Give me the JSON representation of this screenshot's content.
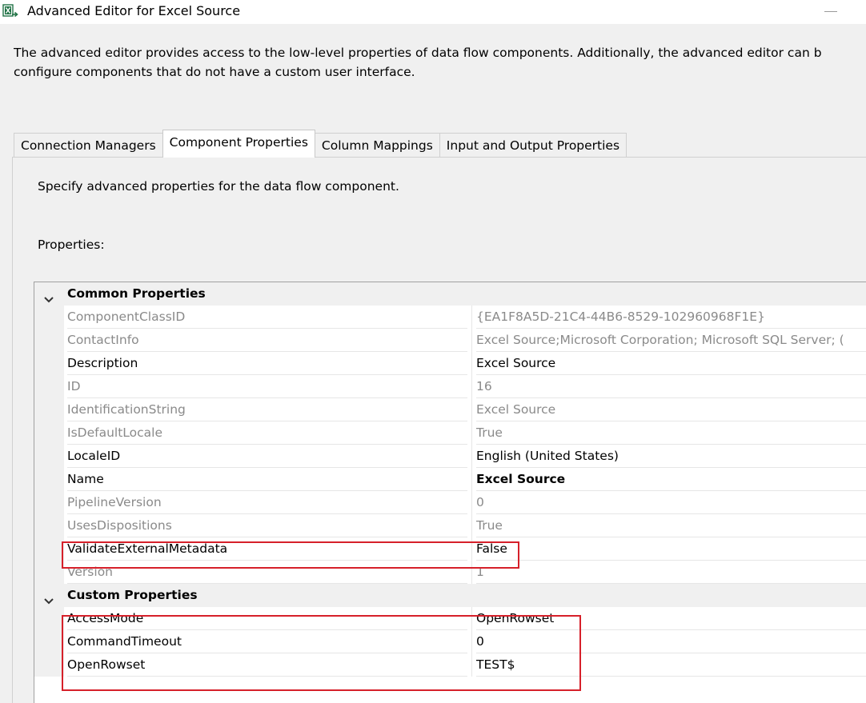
{
  "window": {
    "title": "Advanced Editor for Excel Source",
    "app_icon": "excel-source-icon",
    "minimize_icon": "minimize-icon"
  },
  "description": {
    "line1": "The advanced editor provides access to the low-level properties of data flow components. Additionally, the advanced editor can b",
    "line2": "configure components that do not have a custom user interface."
  },
  "tabs": [
    {
      "label": "Connection Managers",
      "active": false
    },
    {
      "label": "Component Properties",
      "active": true
    },
    {
      "label": "Column Mappings",
      "active": false
    },
    {
      "label": "Input and Output Properties",
      "active": false
    }
  ],
  "panel": {
    "description": "Specify advanced properties for the data flow component.",
    "properties_label": "Properties:"
  },
  "grid": {
    "categories": [
      {
        "label": "Common Properties",
        "expanded": true,
        "rows": [
          {
            "name": "ComponentClassID",
            "value": "{EA1F8A5D-21C4-44B6-8529-102960968F1E}",
            "readonly": true
          },
          {
            "name": "ContactInfo",
            "value": "Excel Source;Microsoft Corporation; Microsoft SQL Server; (",
            "readonly": true
          },
          {
            "name": "Description",
            "value": "Excel Source",
            "readonly": false
          },
          {
            "name": "ID",
            "value": "16",
            "readonly": true
          },
          {
            "name": "IdentificationString",
            "value": "Excel Source",
            "readonly": true
          },
          {
            "name": "IsDefaultLocale",
            "value": "True",
            "readonly": true
          },
          {
            "name": "LocaleID",
            "value": "English (United States)",
            "readonly": false
          },
          {
            "name": "Name",
            "value": "Excel Source",
            "readonly": false,
            "bold_value": true
          },
          {
            "name": "PipelineVersion",
            "value": "0",
            "readonly": true
          },
          {
            "name": "UsesDispositions",
            "value": "True",
            "readonly": true
          },
          {
            "name": "ValidateExternalMetadata",
            "value": "False",
            "readonly": false,
            "highlighted": true
          },
          {
            "name": "Version",
            "value": "1",
            "readonly": true
          }
        ]
      },
      {
        "label": "Custom Properties",
        "expanded": true,
        "rows": [
          {
            "name": "AccessMode",
            "value": "OpenRowset",
            "readonly": false,
            "highlighted": true
          },
          {
            "name": "CommandTimeout",
            "value": "0",
            "readonly": false,
            "highlighted": true
          },
          {
            "name": "OpenRowset",
            "value": "TEST$",
            "readonly": false,
            "highlighted": true
          }
        ]
      }
    ]
  },
  "colors": {
    "highlight": "#d6202a",
    "readonly_text": "#8a8a8a",
    "category_background": "#f0f0f0"
  }
}
